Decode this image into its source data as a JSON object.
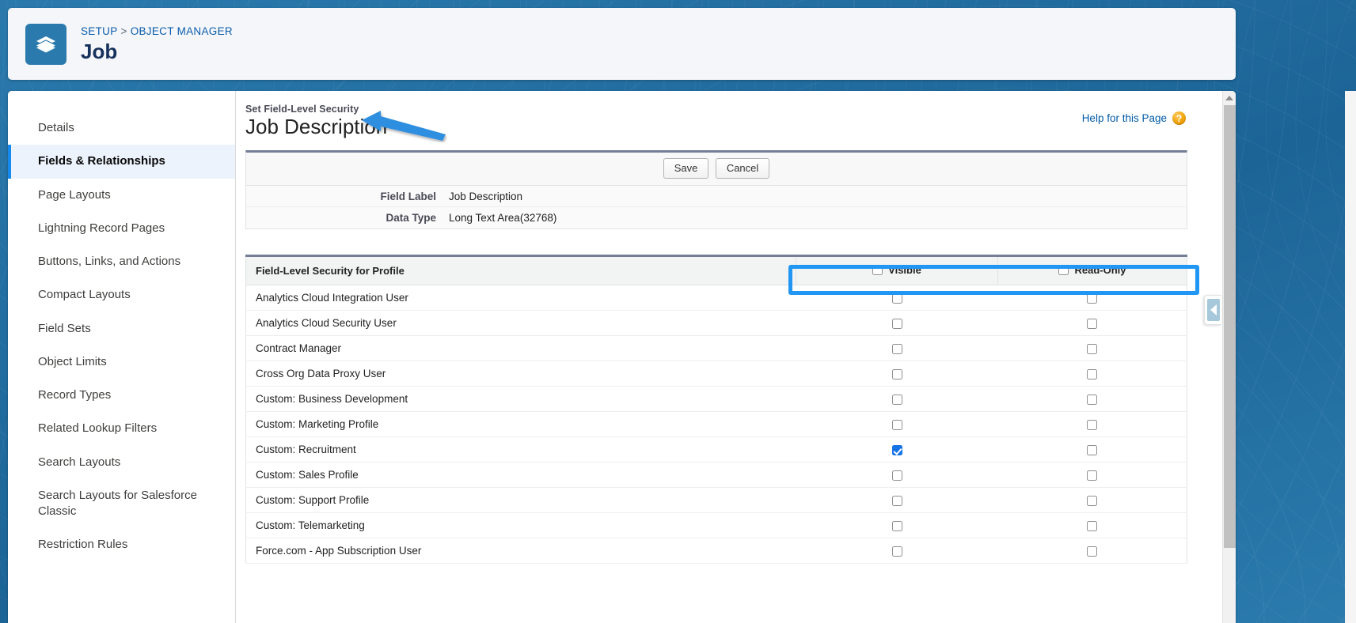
{
  "setup_header": {
    "breadcrumb": {
      "root": "SETUP",
      "separator": ">",
      "current": "OBJECT MANAGER"
    },
    "object_title": "Job",
    "icon": "layers-icon"
  },
  "object_nav": {
    "items": [
      {
        "label": "Details",
        "active": false
      },
      {
        "label": "Fields & Relationships",
        "active": true
      },
      {
        "label": "Page Layouts",
        "active": false
      },
      {
        "label": "Lightning Record Pages",
        "active": false
      },
      {
        "label": "Buttons, Links, and Actions",
        "active": false
      },
      {
        "label": "Compact Layouts",
        "active": false
      },
      {
        "label": "Field Sets",
        "active": false
      },
      {
        "label": "Object Limits",
        "active": false
      },
      {
        "label": "Record Types",
        "active": false
      },
      {
        "label": "Related Lookup Filters",
        "active": false
      },
      {
        "label": "Search Layouts",
        "active": false
      },
      {
        "label": "Search Layouts for Salesforce Classic",
        "active": false
      },
      {
        "label": "Restriction Rules",
        "active": false
      }
    ]
  },
  "page": {
    "eyebrow": "Set Field-Level Security",
    "title": "Job Description",
    "help_link": "Help for this Page",
    "help_icon": "question-mark-badge-icon"
  },
  "actions": {
    "save_label": "Save",
    "cancel_label": "Cancel"
  },
  "field_detail": {
    "rows": [
      {
        "label": "Field Label",
        "value": "Job Description"
      },
      {
        "label": "Data Type",
        "value": "Long Text Area(32768)"
      }
    ]
  },
  "fls_table": {
    "profile_header": "Field-Level Security for Profile",
    "columns": [
      {
        "key": "visible",
        "label": "Visible",
        "header_checked": false
      },
      {
        "key": "readonly",
        "label": "Read-Only",
        "header_checked": false
      }
    ],
    "rows": [
      {
        "profile": "Analytics Cloud Integration User",
        "visible": false,
        "readonly": false
      },
      {
        "profile": "Analytics Cloud Security User",
        "visible": false,
        "readonly": false
      },
      {
        "profile": "Contract Manager",
        "visible": false,
        "readonly": false
      },
      {
        "profile": "Cross Org Data Proxy User",
        "visible": false,
        "readonly": false
      },
      {
        "profile": "Custom: Business Development",
        "visible": false,
        "readonly": false
      },
      {
        "profile": "Custom: Marketing Profile",
        "visible": false,
        "readonly": false
      },
      {
        "profile": "Custom: Recruitment",
        "visible": true,
        "readonly": false
      },
      {
        "profile": "Custom: Sales Profile",
        "visible": false,
        "readonly": false
      },
      {
        "profile": "Custom: Support Profile",
        "visible": false,
        "readonly": false
      },
      {
        "profile": "Custom: Telemarketing",
        "visible": false,
        "readonly": false
      },
      {
        "profile": "Force.com - App Subscription User",
        "visible": false,
        "readonly": false
      }
    ]
  },
  "annotations": {
    "arrow": {
      "name": "blue-arrow-annotation",
      "points_at": "Job Description"
    },
    "box": {
      "name": "blue-highlight-box-annotation",
      "surrounds": "Visible and Read-Only column headers"
    }
  },
  "colors": {
    "accent_blue": "#1589ee",
    "annotation_blue": "#2196f3",
    "brand_teal": "#2a7aad",
    "link_blue": "#015ba7",
    "checkbox_checked": "#1673e6",
    "panel_header_rule": "#747e96"
  }
}
